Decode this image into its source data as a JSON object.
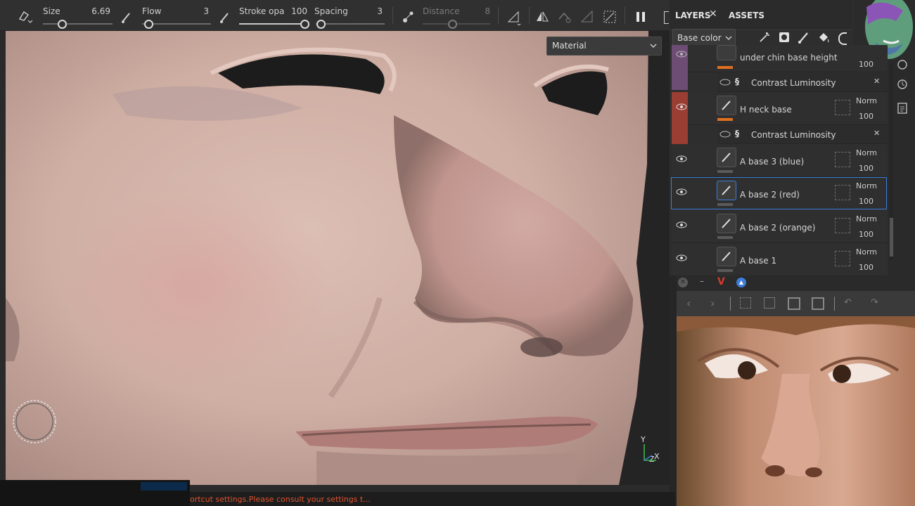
{
  "toolbar": {
    "size_label": "Size",
    "size_value": "6.69",
    "flow_label": "Flow",
    "flow_value": "3",
    "stroke_label": "Stroke opa",
    "stroke_value": "100",
    "spacing_label": "Spacing",
    "spacing_value": "3",
    "distance_label": "Distance",
    "distance_value": "8"
  },
  "viewport": {
    "material_dropdown": "Material",
    "axis_y": "Y",
    "axis_z": "Z",
    "axis_x": "X"
  },
  "panel": {
    "tab_layers": "LAYERS",
    "tab_assets": "ASSETS",
    "channel_select": "Base color",
    "layers": [
      {
        "name": "under chin base height",
        "opacity": "100",
        "color": "#6e4d75",
        "bar": "#e07020"
      },
      {
        "name": "H neck base",
        "blend": "Norm",
        "opacity": "100",
        "color": "#9a3d32",
        "bar": "#e07020"
      },
      {
        "name": "A base 3 (blue)",
        "blend": "Norm",
        "opacity": "100"
      },
      {
        "name": "A base 2 (red)",
        "blend": "Norm",
        "opacity": "100",
        "selected": true
      },
      {
        "name": "A base 2 (orange)",
        "blend": "Norm",
        "opacity": "100"
      },
      {
        "name": "A base 1",
        "blend": "Norm",
        "opacity": "100"
      }
    ],
    "effects": [
      {
        "name": "Contrast Luminosity"
      },
      {
        "name": "Contrast Luminosity"
      }
    ],
    "selection_color": "#3d7ed8"
  },
  "status": {
    "message": "ortcut settings.Please consult your settings t..."
  }
}
